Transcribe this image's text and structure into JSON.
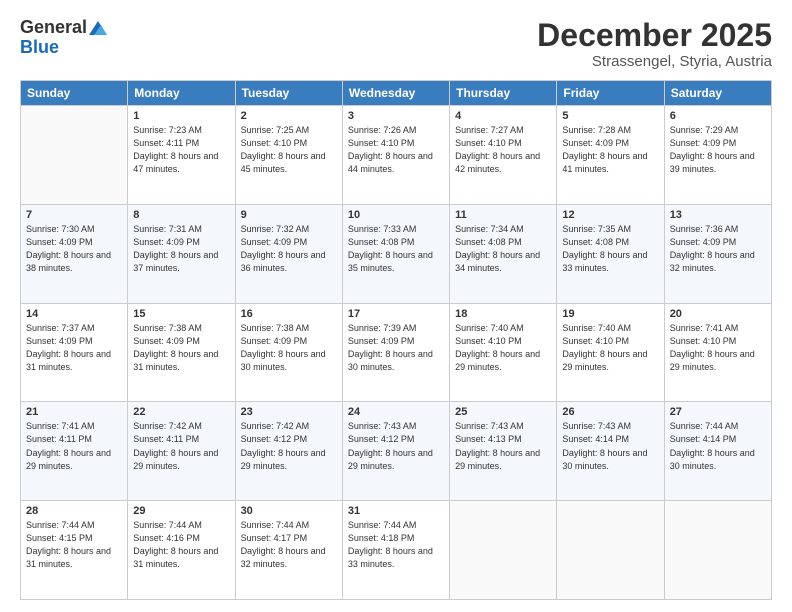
{
  "header": {
    "logo_general": "General",
    "logo_blue": "Blue",
    "month_title": "December 2025",
    "location": "Strassengel, Styria, Austria"
  },
  "weekdays": [
    "Sunday",
    "Monday",
    "Tuesday",
    "Wednesday",
    "Thursday",
    "Friday",
    "Saturday"
  ],
  "weeks": [
    [
      {
        "day": "",
        "sunrise": "",
        "sunset": "",
        "daylight": ""
      },
      {
        "day": "1",
        "sunrise": "Sunrise: 7:23 AM",
        "sunset": "Sunset: 4:11 PM",
        "daylight": "Daylight: 8 hours and 47 minutes."
      },
      {
        "day": "2",
        "sunrise": "Sunrise: 7:25 AM",
        "sunset": "Sunset: 4:10 PM",
        "daylight": "Daylight: 8 hours and 45 minutes."
      },
      {
        "day": "3",
        "sunrise": "Sunrise: 7:26 AM",
        "sunset": "Sunset: 4:10 PM",
        "daylight": "Daylight: 8 hours and 44 minutes."
      },
      {
        "day": "4",
        "sunrise": "Sunrise: 7:27 AM",
        "sunset": "Sunset: 4:10 PM",
        "daylight": "Daylight: 8 hours and 42 minutes."
      },
      {
        "day": "5",
        "sunrise": "Sunrise: 7:28 AM",
        "sunset": "Sunset: 4:09 PM",
        "daylight": "Daylight: 8 hours and 41 minutes."
      },
      {
        "day": "6",
        "sunrise": "Sunrise: 7:29 AM",
        "sunset": "Sunset: 4:09 PM",
        "daylight": "Daylight: 8 hours and 39 minutes."
      }
    ],
    [
      {
        "day": "7",
        "sunrise": "Sunrise: 7:30 AM",
        "sunset": "Sunset: 4:09 PM",
        "daylight": "Daylight: 8 hours and 38 minutes."
      },
      {
        "day": "8",
        "sunrise": "Sunrise: 7:31 AM",
        "sunset": "Sunset: 4:09 PM",
        "daylight": "Daylight: 8 hours and 37 minutes."
      },
      {
        "day": "9",
        "sunrise": "Sunrise: 7:32 AM",
        "sunset": "Sunset: 4:09 PM",
        "daylight": "Daylight: 8 hours and 36 minutes."
      },
      {
        "day": "10",
        "sunrise": "Sunrise: 7:33 AM",
        "sunset": "Sunset: 4:08 PM",
        "daylight": "Daylight: 8 hours and 35 minutes."
      },
      {
        "day": "11",
        "sunrise": "Sunrise: 7:34 AM",
        "sunset": "Sunset: 4:08 PM",
        "daylight": "Daylight: 8 hours and 34 minutes."
      },
      {
        "day": "12",
        "sunrise": "Sunrise: 7:35 AM",
        "sunset": "Sunset: 4:08 PM",
        "daylight": "Daylight: 8 hours and 33 minutes."
      },
      {
        "day": "13",
        "sunrise": "Sunrise: 7:36 AM",
        "sunset": "Sunset: 4:09 PM",
        "daylight": "Daylight: 8 hours and 32 minutes."
      }
    ],
    [
      {
        "day": "14",
        "sunrise": "Sunrise: 7:37 AM",
        "sunset": "Sunset: 4:09 PM",
        "daylight": "Daylight: 8 hours and 31 minutes."
      },
      {
        "day": "15",
        "sunrise": "Sunrise: 7:38 AM",
        "sunset": "Sunset: 4:09 PM",
        "daylight": "Daylight: 8 hours and 31 minutes."
      },
      {
        "day": "16",
        "sunrise": "Sunrise: 7:38 AM",
        "sunset": "Sunset: 4:09 PM",
        "daylight": "Daylight: 8 hours and 30 minutes."
      },
      {
        "day": "17",
        "sunrise": "Sunrise: 7:39 AM",
        "sunset": "Sunset: 4:09 PM",
        "daylight": "Daylight: 8 hours and 30 minutes."
      },
      {
        "day": "18",
        "sunrise": "Sunrise: 7:40 AM",
        "sunset": "Sunset: 4:10 PM",
        "daylight": "Daylight: 8 hours and 29 minutes."
      },
      {
        "day": "19",
        "sunrise": "Sunrise: 7:40 AM",
        "sunset": "Sunset: 4:10 PM",
        "daylight": "Daylight: 8 hours and 29 minutes."
      },
      {
        "day": "20",
        "sunrise": "Sunrise: 7:41 AM",
        "sunset": "Sunset: 4:10 PM",
        "daylight": "Daylight: 8 hours and 29 minutes."
      }
    ],
    [
      {
        "day": "21",
        "sunrise": "Sunrise: 7:41 AM",
        "sunset": "Sunset: 4:11 PM",
        "daylight": "Daylight: 8 hours and 29 minutes."
      },
      {
        "day": "22",
        "sunrise": "Sunrise: 7:42 AM",
        "sunset": "Sunset: 4:11 PM",
        "daylight": "Daylight: 8 hours and 29 minutes."
      },
      {
        "day": "23",
        "sunrise": "Sunrise: 7:42 AM",
        "sunset": "Sunset: 4:12 PM",
        "daylight": "Daylight: 8 hours and 29 minutes."
      },
      {
        "day": "24",
        "sunrise": "Sunrise: 7:43 AM",
        "sunset": "Sunset: 4:12 PM",
        "daylight": "Daylight: 8 hours and 29 minutes."
      },
      {
        "day": "25",
        "sunrise": "Sunrise: 7:43 AM",
        "sunset": "Sunset: 4:13 PM",
        "daylight": "Daylight: 8 hours and 29 minutes."
      },
      {
        "day": "26",
        "sunrise": "Sunrise: 7:43 AM",
        "sunset": "Sunset: 4:14 PM",
        "daylight": "Daylight: 8 hours and 30 minutes."
      },
      {
        "day": "27",
        "sunrise": "Sunrise: 7:44 AM",
        "sunset": "Sunset: 4:14 PM",
        "daylight": "Daylight: 8 hours and 30 minutes."
      }
    ],
    [
      {
        "day": "28",
        "sunrise": "Sunrise: 7:44 AM",
        "sunset": "Sunset: 4:15 PM",
        "daylight": "Daylight: 8 hours and 31 minutes."
      },
      {
        "day": "29",
        "sunrise": "Sunrise: 7:44 AM",
        "sunset": "Sunset: 4:16 PM",
        "daylight": "Daylight: 8 hours and 31 minutes."
      },
      {
        "day": "30",
        "sunrise": "Sunrise: 7:44 AM",
        "sunset": "Sunset: 4:17 PM",
        "daylight": "Daylight: 8 hours and 32 minutes."
      },
      {
        "day": "31",
        "sunrise": "Sunrise: 7:44 AM",
        "sunset": "Sunset: 4:18 PM",
        "daylight": "Daylight: 8 hours and 33 minutes."
      },
      {
        "day": "",
        "sunrise": "",
        "sunset": "",
        "daylight": ""
      },
      {
        "day": "",
        "sunrise": "",
        "sunset": "",
        "daylight": ""
      },
      {
        "day": "",
        "sunrise": "",
        "sunset": "",
        "daylight": ""
      }
    ]
  ]
}
